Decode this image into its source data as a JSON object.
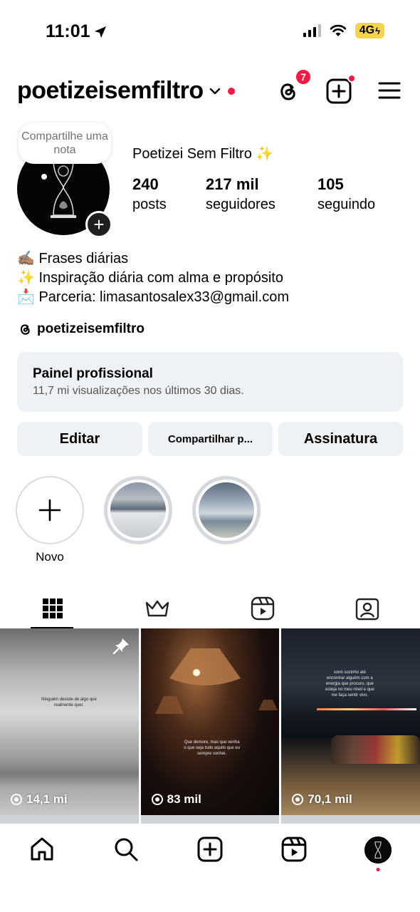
{
  "status": {
    "time": "11:01",
    "network": "4G"
  },
  "header": {
    "username": "poetizeisemfiltro",
    "threads_badge": "7"
  },
  "note": {
    "text": "Compartilhe uma nota"
  },
  "profile": {
    "full_name": "Poetizei Sem Filtro ✨",
    "stats": [
      {
        "value": "240",
        "label": "posts"
      },
      {
        "value": "217 mil",
        "label": "seguidores"
      },
      {
        "value": "105",
        "label": "seguindo"
      }
    ],
    "bio": [
      {
        "emoji": "✍🏽",
        "text": "Frases diárias"
      },
      {
        "emoji": "✨",
        "text": "Inspiração diária com alma e propósito"
      },
      {
        "emoji": "📩",
        "text": "Parceria: limasantosalex33@gmail.com"
      }
    ],
    "threads_handle": "poetizeisemfiltro"
  },
  "pro_panel": {
    "title": "Painel profissional",
    "subtitle": "11,7 mi visualizações nos últimos 30 dias."
  },
  "buttons": {
    "edit": "Editar",
    "share": "Compartilhar p...",
    "subscription": "Assinatura"
  },
  "highlights": {
    "new_label": "Novo"
  },
  "posts": [
    {
      "views": "14,1 mi",
      "caption": "Ninguém desiste de algo que realmente quer."
    },
    {
      "views": "83 mil",
      "caption": "Que demore, mas que venha o que seja tudo aquilo que eu sempre sonhei."
    },
    {
      "views": "70,1 mil",
      "caption": "sonó sozinho até encontrar alguém com a energia que procuro, que esteja no meu nível e que me faça sentir vivo."
    }
  ],
  "colors": {
    "accent_red": "#ff1744",
    "button_bg": "#eff2f5"
  }
}
